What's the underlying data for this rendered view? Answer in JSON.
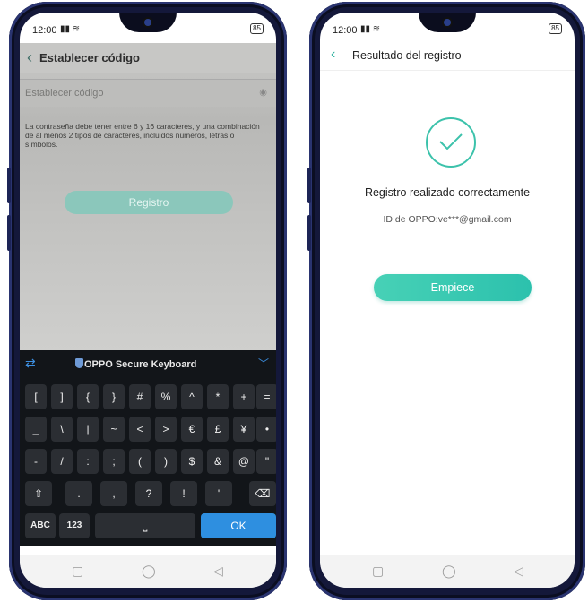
{
  "left_phone": {
    "status": {
      "time": "12:00",
      "battery": "85"
    },
    "photo_screen": {
      "title": "Establecer código",
      "field_placeholder": "Establecer código",
      "hint": "La contraseña debe tener entre 6 y 16 caracteres, y una combinación de al menos 2 tipos de caracteres, incluidos números, letras o símbolos.",
      "submit_label": "Registro"
    },
    "keyboard": {
      "title": "OPPO Secure Keyboard",
      "rows": [
        [
          "[",
          "]",
          "{",
          "}",
          "#",
          "%",
          "^",
          "*",
          "+",
          "="
        ],
        [
          "_",
          "\\",
          "|",
          "~",
          "<",
          ">",
          "€",
          "£",
          "¥",
          "•"
        ],
        [
          "-",
          "/",
          ":",
          ";",
          "(",
          ")",
          "$",
          "&",
          "@",
          "\""
        ],
        [
          ".",
          ",",
          "?",
          "!",
          "'"
        ]
      ],
      "mode_label": "ABC",
      "num_label": "123",
      "space_label": "⎵",
      "ok_label": "OK"
    }
  },
  "right_phone": {
    "status": {
      "time": "12:00",
      "battery": "85"
    },
    "header_title": "Resultado del registro",
    "success_message": "Registro realizado correctamente",
    "account_id": "ID de OPPO:ve***@gmail.com",
    "start_label": "Empiece"
  },
  "colors": {
    "accent": "#3cc2ab",
    "keyboard_blue": "#2e8fe0"
  }
}
